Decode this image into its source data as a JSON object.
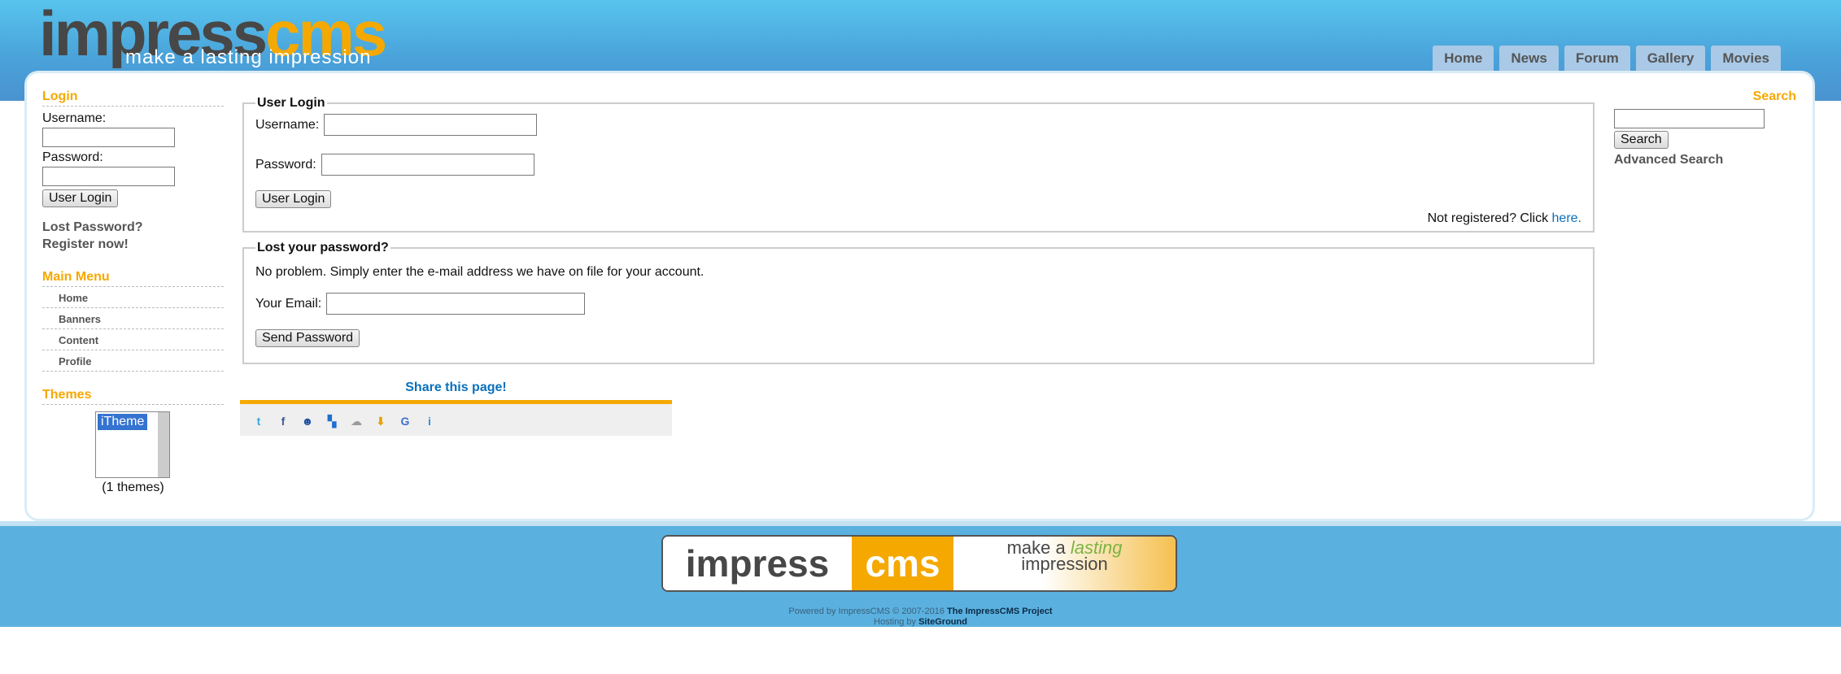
{
  "header": {
    "logo_impress": "impress",
    "logo_cms": "cms",
    "logo_tagline": "make a lasting impression",
    "nav_tabs": [
      {
        "label": "Home"
      },
      {
        "label": "News"
      },
      {
        "label": "Forum"
      },
      {
        "label": "Gallery"
      },
      {
        "label": "Movies"
      }
    ]
  },
  "left_sidebar": {
    "login_block": {
      "title": "Login",
      "username_label": "Username:",
      "username_value": "",
      "password_label": "Password:",
      "password_value": "",
      "login_button": "User Login",
      "lost_password": "Lost Password?",
      "register": "Register now!"
    },
    "main_menu": {
      "title": "Main Menu",
      "items": [
        {
          "label": "Home"
        },
        {
          "label": "Banners"
        },
        {
          "label": "Content"
        },
        {
          "label": "Profile"
        }
      ]
    },
    "themes": {
      "title": "Themes",
      "options": [
        "iTheme"
      ],
      "selected": "iTheme",
      "count_text": "(1 themes)"
    }
  },
  "main": {
    "user_login": {
      "legend": "User Login",
      "username_label": "Username:",
      "username_value": "",
      "password_label": "Password:",
      "password_value": "",
      "login_button": "User Login",
      "not_registered": "Not registered? Click",
      "here_link": "here."
    },
    "lost_password": {
      "legend": "Lost your password?",
      "description": "No problem. Simply enter the e-mail address we have on file for your account.",
      "email_label": "Your Email:",
      "email_value": "",
      "send_button": "Send Password"
    },
    "share": {
      "title": "Share this page!",
      "icons": [
        {
          "name": "twitter-icon",
          "glyph": "t",
          "color": "#34a8e0"
        },
        {
          "name": "facebook-icon",
          "glyph": "f",
          "color": "#3b5998"
        },
        {
          "name": "myspace-icon",
          "glyph": "☻",
          "color": "#1f4fa0"
        },
        {
          "name": "delicious-icon",
          "glyph": "▚",
          "color": "#1f6fd0"
        },
        {
          "name": "digg-icon",
          "glyph": "☁",
          "color": "#9a9a9a"
        },
        {
          "name": "download-icon",
          "glyph": "⬇",
          "color": "#e4a100"
        },
        {
          "name": "google-icon",
          "glyph": "G",
          "color": "#3c6fd0"
        },
        {
          "name": "identica-icon",
          "glyph": "i",
          "color": "#2f8fd6"
        }
      ]
    }
  },
  "right_sidebar": {
    "title": "Search",
    "search_value": "",
    "search_button": "Search",
    "advanced_search": "Advanced Search"
  },
  "footer": {
    "logo_impress": "impress",
    "logo_cms": "cms",
    "logo_tag_make": "make a",
    "logo_tag_lasting": "lasting",
    "logo_tag_impression": "impression",
    "powered_by": "Powered by ImpressCMS © 2007-2016",
    "project": "The ImpressCMS Project",
    "hosting_by": "Hosting by",
    "host": "SiteGround"
  },
  "colors": {
    "accent": "#f5a800",
    "header_blue": "#4aa3da",
    "link_blue": "#0a70bc"
  }
}
